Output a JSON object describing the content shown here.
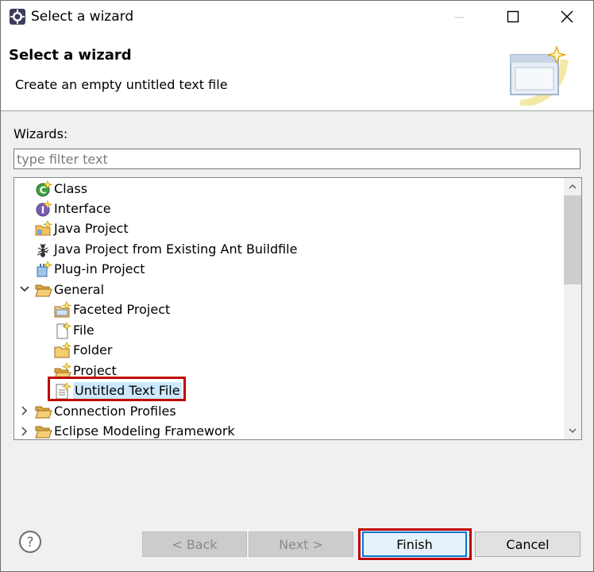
{
  "window": {
    "title": "Select a wizard",
    "controls": [
      "minimize",
      "maximize",
      "close"
    ]
  },
  "header": {
    "title": "Select a wizard",
    "description": "Create an empty untitled text file"
  },
  "wizards": {
    "label": "Wizards:",
    "filter_placeholder": "type filter text",
    "filter_value": ""
  },
  "tree": {
    "items": [
      {
        "label": "Class",
        "icon": "java-class-icon",
        "depth": 1,
        "expanded": null
      },
      {
        "label": "Interface",
        "icon": "java-interface-icon",
        "depth": 1,
        "expanded": null
      },
      {
        "label": "Java Project",
        "icon": "java-project-icon",
        "depth": 1,
        "expanded": null
      },
      {
        "label": "Java Project from Existing Ant Buildfile",
        "icon": "ant-icon",
        "depth": 1,
        "expanded": null
      },
      {
        "label": "Plug-in Project",
        "icon": "plugin-project-icon",
        "depth": 1,
        "expanded": null
      },
      {
        "label": "General",
        "icon": "folder-open-icon",
        "depth": 1,
        "expanded": true
      },
      {
        "label": "Faceted Project",
        "icon": "faceted-project-icon",
        "depth": 2,
        "expanded": null
      },
      {
        "label": "File",
        "icon": "new-file-icon",
        "depth": 2,
        "expanded": null
      },
      {
        "label": "Folder",
        "icon": "new-folder-icon",
        "depth": 2,
        "expanded": null
      },
      {
        "label": "Project",
        "icon": "new-project-icon",
        "depth": 2,
        "expanded": null
      },
      {
        "label": "Untitled Text File",
        "icon": "text-file-icon",
        "depth": 2,
        "expanded": null,
        "selected": true
      },
      {
        "label": "Connection Profiles",
        "icon": "folder-open-icon",
        "depth": 1,
        "expanded": false
      },
      {
        "label": "Eclipse Modeling Framework",
        "icon": "folder-open-icon",
        "depth": 1,
        "expanded": false
      }
    ]
  },
  "buttons": {
    "back": "< Back",
    "next": "Next >",
    "finish": "Finish",
    "cancel": "Cancel"
  },
  "colors": {
    "selection_bg": "#cce8ff",
    "annotation_red": "#c00000",
    "default_button_border": "#0078d7"
  }
}
